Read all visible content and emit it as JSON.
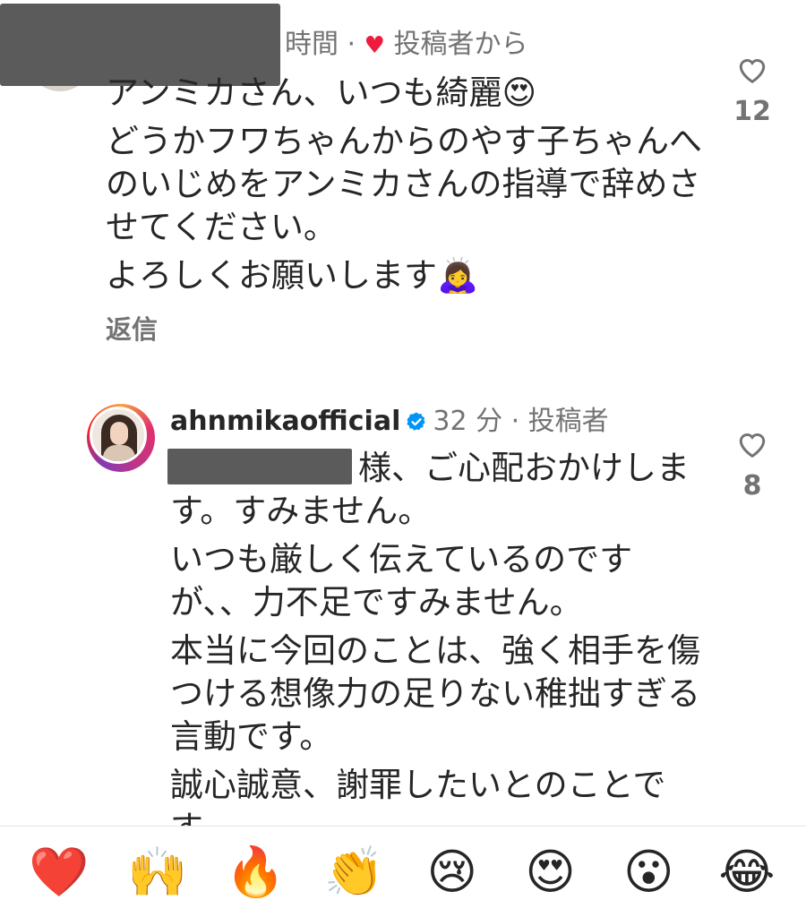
{
  "comment1": {
    "meta_time": "時間 ·",
    "meta_heart": "♥",
    "meta_author_tag": "投稿者から",
    "lines": [
      "アンミカさん、いつも綺麗😍",
      "どうかフワちゃんからのやす子ちゃんへのいじめをアンミカさんの指導で辞めさせてください。",
      "よろしくお願いします🙇‍♀️"
    ],
    "like_count": "12",
    "reply_label": "返信"
  },
  "reply": {
    "username": "ahnmikaofficial",
    "meta": "32 分 · 投稿者",
    "lines": [
      "様、ご心配おかけします。すみません。",
      "いつも厳しく伝えているのですが、、力不足ですみません。",
      "本当に今回のことは、強く相手を傷つける想像力の足りない稚拙すぎる言動です。",
      "誠心誠意、謝罪したいとのことです。"
    ],
    "like_count": "8"
  },
  "emoji_bar": {
    "emojis": [
      "❤️",
      "🙌",
      "🔥",
      "👏",
      "😢",
      "😍",
      "😮",
      "😂"
    ]
  },
  "icons": {
    "like": "heart-outline-icon",
    "verified": "verified-badge-icon"
  },
  "colors": {
    "text": "#262626",
    "muted": "#737373",
    "heart": "#ed1c3c",
    "verified": "#0095f6",
    "redaction": "#5b5b5b"
  }
}
